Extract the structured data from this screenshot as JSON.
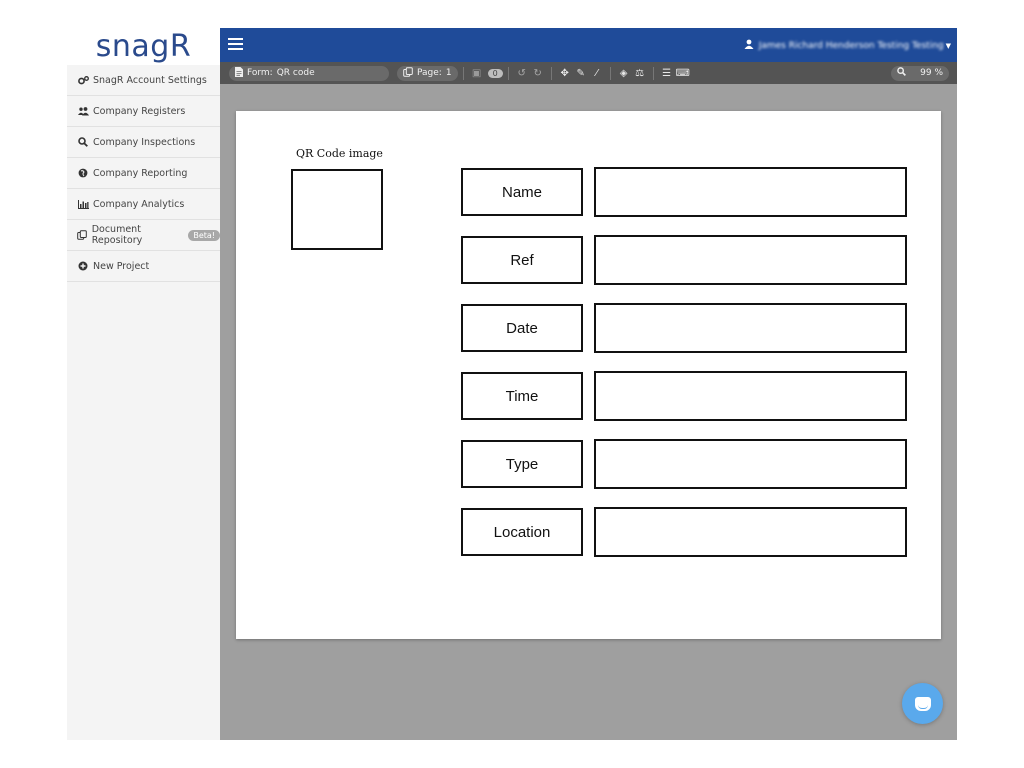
{
  "logo": {
    "text": "snagR",
    "accent": "▸"
  },
  "sidebar": {
    "items": [
      {
        "label": "SnagR Account Settings",
        "icon": "gears-icon"
      },
      {
        "label": "Company Registers",
        "icon": "users-icon"
      },
      {
        "label": "Company Inspections",
        "icon": "search-icon"
      },
      {
        "label": "Company Reporting",
        "icon": "globe-icon"
      },
      {
        "label": "Company Analytics",
        "icon": "bar-chart-icon"
      },
      {
        "label": "Document Repository",
        "icon": "copy-icon",
        "badge": "Beta!"
      },
      {
        "label": "New Project",
        "icon": "plus-circle-icon"
      }
    ]
  },
  "topbar": {
    "user_name": "James Richard Henderson Testing Testing",
    "user_icon": "user-icon"
  },
  "toolbar": {
    "form_label": "Form:",
    "form_name": "QR code",
    "page_label": "Page:",
    "page_number": "1",
    "save_count": "0",
    "zoom": "99 %"
  },
  "canvas": {
    "qr_label": "QR Code image",
    "fields": [
      "Name",
      "Ref",
      "Date",
      "Time",
      "Type",
      "Location"
    ]
  },
  "colors": {
    "topbar": "#1f4b99",
    "toolbar": "#545454",
    "workspace": "#9f9f9f",
    "sidebar": "#f4f4f4",
    "chat": "#5aa9ec",
    "logo": "#2a4a8c"
  }
}
